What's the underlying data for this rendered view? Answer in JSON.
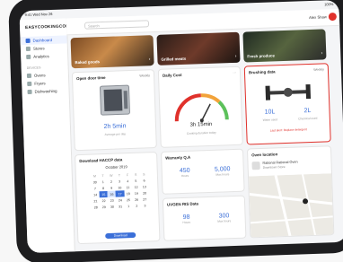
{
  "status_bar": {
    "left": "9:41 Wed Nov 26",
    "right": "100%"
  },
  "sidebar": {
    "logo": "EASYCOOKINGCONNECT",
    "items": [
      {
        "label": "Dashboard",
        "active": true
      },
      {
        "label": "Stores",
        "active": false
      },
      {
        "label": "Analytics",
        "active": false
      }
    ],
    "section": "DEVICES",
    "devices": [
      {
        "label": "Ovens"
      },
      {
        "label": "Fryers"
      },
      {
        "label": "Dishwashing"
      }
    ]
  },
  "topbar": {
    "search_placeholder": "Search",
    "user_name": "Alex Shaw"
  },
  "banners": [
    {
      "caption": "Baked goods"
    },
    {
      "caption": "Grilled meats"
    },
    {
      "caption": "Fresh produce"
    }
  ],
  "open_door": {
    "title": "Open door time",
    "menu": "Weekly",
    "value": "2h 5min",
    "sub": "Average per day"
  },
  "daily_cost": {
    "title": "Daily Cost",
    "value": "3h 15min",
    "sub": "Cooking duration today"
  },
  "brushing": {
    "title": "Brushing data",
    "menu": "Weekly",
    "left_value": "10L",
    "left_label": "Water used",
    "right_value": "2L",
    "right_label": "Chemical used",
    "alert": "Last alert: Replace detergent"
  },
  "calendar": {
    "title": "Download HACCP data",
    "month": "October 2019",
    "days": [
      "M",
      "T",
      "W",
      "T",
      "F",
      "S",
      "S"
    ],
    "weeks": [
      [
        "30",
        "1",
        "2",
        "3",
        "4",
        "5",
        "6"
      ],
      [
        "7",
        "8",
        "9",
        "10",
        "11",
        "12",
        "13"
      ],
      [
        "14",
        "15",
        "16",
        "17",
        "18",
        "19",
        "20"
      ],
      [
        "21",
        "22",
        "23",
        "24",
        "25",
        "26",
        "27"
      ],
      [
        "28",
        "29",
        "30",
        "31",
        "1",
        "2",
        "3"
      ]
    ],
    "button": "Download"
  },
  "warranty": {
    "title": "Warranty Q.A",
    "a": "450",
    "a_label": "Hours",
    "b": "5,000",
    "b_label": "Max hours"
  },
  "uvgen": {
    "title": "UVGEN RIS Data",
    "a": "98",
    "a_label": "Hours",
    "b": "300",
    "b_label": "Max hours"
  },
  "oven_location": {
    "title": "Oven location",
    "name": "Rational Rational Oven",
    "address": "Downtown Store"
  },
  "colors": {
    "accent": "#3b6fd8",
    "alert": "#e0312b",
    "gauge_green": "#5cc15b",
    "gauge_orange": "#f2a33a"
  },
  "icons": [
    "search-icon",
    "chevron-right-icon",
    "more-icon",
    "pin-icon",
    "oven-icon",
    "axle-icon"
  ]
}
